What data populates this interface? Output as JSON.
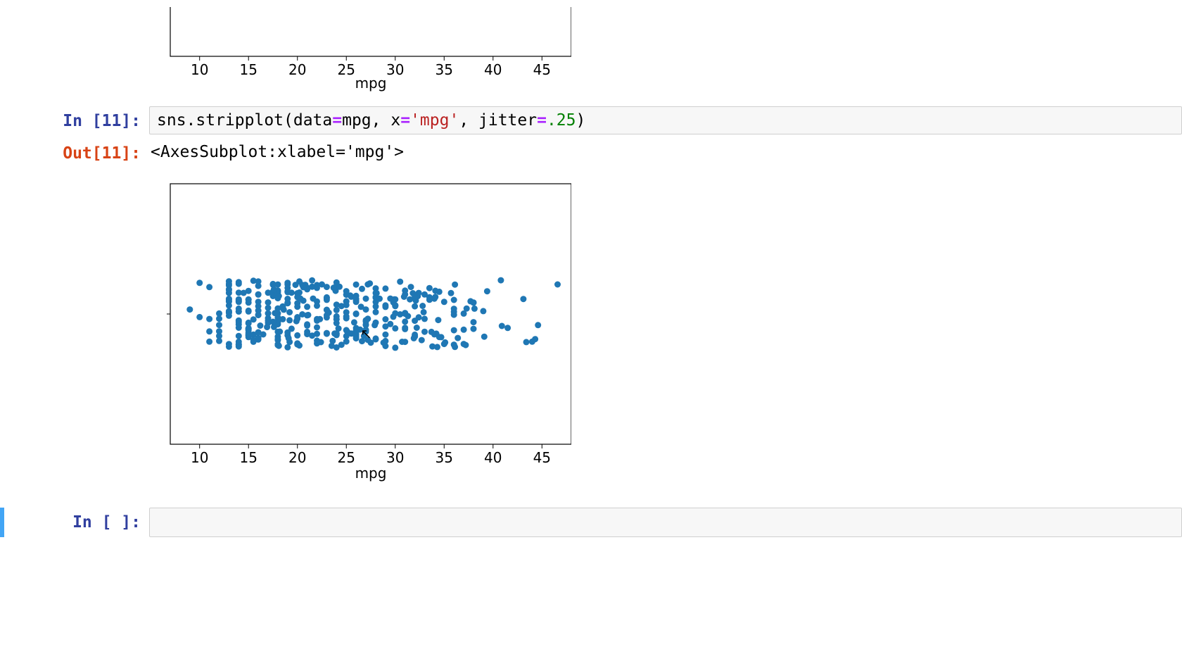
{
  "cells": {
    "prev_fig_xlabel": "mpg",
    "in11_label": "In [11]:",
    "in11_code": {
      "prefix": "sns.stripplot(data",
      "eq1": "=",
      "mpgvar": "mpg, x",
      "eq2": "=",
      "str_mpg": "'mpg'",
      "comma": ", jitter",
      "eq3": "=",
      "num": ".25",
      "close": ")"
    },
    "out11_label": "Out[11]:",
    "out11_text": "<AxesSubplot:xlabel='mpg'>",
    "fig2_xlabel": "mpg",
    "empty_in_label": "In [ ]:"
  },
  "chart_data": [
    {
      "id": "fig_prev_partial",
      "type": "scatter",
      "xlabel": "mpg",
      "xticks": [
        10,
        15,
        20,
        25,
        30,
        35,
        40,
        45
      ],
      "xlim": [
        7,
        48
      ],
      "note": "Only bottom axis of a previous stripplot is visible; no data points shown in the cropped region."
    },
    {
      "id": "fig_out11",
      "type": "scatter",
      "xlabel": "mpg",
      "xticks": [
        10,
        15,
        20,
        25,
        30,
        35,
        40,
        45
      ],
      "xlim": [
        7,
        48
      ],
      "ylim": [
        -0.5,
        0.5
      ],
      "jitter": 0.25,
      "point_color": "#1f77b4",
      "mpg_values": [
        18,
        15,
        18,
        16,
        17,
        15,
        14,
        14,
        14,
        15,
        15,
        14,
        15,
        14,
        24,
        22,
        18,
        21,
        27,
        26,
        25,
        24,
        25,
        26,
        21,
        10,
        10,
        11,
        9,
        27,
        28,
        25,
        25,
        19,
        16,
        17,
        19,
        18,
        14,
        14,
        14,
        14,
        12,
        13,
        13,
        18,
        22,
        19,
        18,
        23,
        28,
        30,
        30,
        31,
        35,
        27,
        26,
        24,
        25,
        23,
        20,
        21,
        13,
        14,
        15,
        14,
        17,
        11,
        13,
        12,
        13,
        19,
        15,
        13,
        13,
        14,
        18,
        22,
        21,
        26,
        22,
        28,
        23,
        28,
        27,
        13,
        14,
        13,
        14,
        15,
        12,
        13,
        13,
        14,
        13,
        12,
        13,
        18,
        16,
        18,
        18,
        23,
        26,
        11,
        12,
        13,
        12,
        18,
        20,
        21,
        22,
        18,
        19,
        21,
        26,
        15,
        16,
        29,
        24,
        20,
        19,
        15,
        24,
        20,
        11,
        20,
        21,
        19,
        15,
        31,
        26,
        32,
        25,
        16,
        16,
        18,
        16,
        13,
        14,
        14,
        14,
        29,
        26,
        26,
        31,
        32,
        28,
        24,
        26,
        24,
        26,
        31,
        19,
        18,
        15,
        15,
        16,
        15,
        16,
        14,
        17,
        16,
        15,
        18,
        21,
        20,
        13,
        29,
        23,
        20,
        23,
        24,
        25,
        24,
        18,
        29,
        19,
        23,
        23,
        22,
        25,
        33,
        28,
        25,
        25,
        26,
        27,
        17.5,
        16,
        15.5,
        14.5,
        22,
        22,
        24,
        22.5,
        29,
        24.5,
        29,
        33,
        20,
        18,
        18.5,
        17.5,
        29.5,
        32,
        28,
        26.5,
        20,
        13,
        19,
        19,
        31,
        30,
        36,
        25.5,
        33.5,
        17.5,
        17,
        15.5,
        15,
        17.5,
        20.5,
        19,
        18.5,
        16,
        15.5,
        15.5,
        16,
        29,
        24.5,
        26,
        25.5,
        30.5,
        33.5,
        30,
        30.5,
        22,
        21.5,
        21.5,
        43.1,
        36.1,
        32.8,
        39.4,
        36.1,
        19.9,
        19.4,
        20.2,
        19.2,
        25.1,
        20.5,
        19.4,
        20.6,
        20.8,
        18.6,
        18.1,
        19.2,
        17.7,
        18.1,
        17.5,
        30,
        27.5,
        27.2,
        30.9,
        21.1,
        23.2,
        23.8,
        23.9,
        20.3,
        17,
        21.6,
        16.2,
        31.5,
        29.5,
        21.5,
        19.8,
        22.3,
        20.2,
        20.6,
        17,
        17.6,
        16.5,
        18.2,
        16.9,
        15.5,
        19.2,
        18.5,
        31.9,
        34.1,
        35.7,
        27.4,
        25.4,
        23,
        27.2,
        23.9,
        34.2,
        34.5,
        31.8,
        37.3,
        28.4,
        28.8,
        26.8,
        33.5,
        41.5,
        38.1,
        32.1,
        37.2,
        28,
        26.4,
        24.3,
        19.1,
        34.3,
        29.8,
        31.3,
        37,
        32.2,
        46.6,
        27.9,
        40.8,
        44.3,
        43.4,
        36.4,
        30,
        44.6,
        40.9,
        33.8,
        29.8,
        32.7,
        23.7,
        35,
        23.6,
        32.4,
        27.2,
        26.6,
        25.8,
        23.5,
        30,
        39.1,
        39,
        35.1,
        32.3,
        37,
        37.7,
        34.1,
        34.7,
        34.4,
        29.9,
        33,
        34.5,
        33.7,
        32.4,
        32.9,
        31.6,
        28.1,
        30.7,
        24.2,
        22.4,
        26.6,
        20.2,
        17.6,
        28,
        27,
        34,
        31,
        29,
        27,
        24,
        23,
        36,
        37,
        31,
        38,
        36,
        36,
        36,
        34,
        38,
        32,
        38,
        25,
        38,
        26,
        22,
        32,
        36,
        27,
        27,
        44,
        32,
        28,
        31
      ]
    }
  ]
}
